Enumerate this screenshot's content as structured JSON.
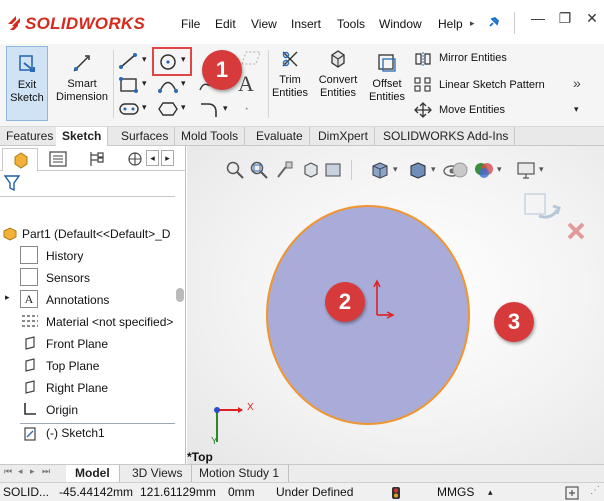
{
  "app": {
    "logo_text": "SOLIDWORKS"
  },
  "menu": {
    "items": [
      "File",
      "Edit",
      "View",
      "Insert",
      "Tools",
      "Window",
      "Help"
    ]
  },
  "ribbon": {
    "exit_sketch": "Exit\nSketch",
    "smart_dimension": "Smart\nDimension",
    "trim_entities": "Trim\nEntities",
    "convert_entities": "Convert\nEntities",
    "offset_entities": "Offset\nEntities",
    "mirror_entities": "Mirror Entities",
    "linear_sketch_pattern": "Linear Sketch Pattern",
    "move_entities": "Move Entities"
  },
  "tabs": [
    "Features",
    "Sketch",
    "Surfaces",
    "Mold Tools",
    "Evaluate",
    "DimXpert",
    "SOLIDWORKS Add-Ins"
  ],
  "active_tab": "Sketch",
  "tree": {
    "root": "Part1  (Default<<Default>_D",
    "items": [
      "History",
      "Sensors",
      "Annotations",
      "Material <not specified>",
      "Front Plane",
      "Top Plane",
      "Right Plane",
      "Origin",
      "(-) Sketch1"
    ]
  },
  "viewport": {
    "triad_x": "X",
    "triad_y": "Y",
    "view_label": "*Top",
    "circle_fill": "#a9acd9",
    "circle_stroke": "#f0952f"
  },
  "callouts": [
    "1",
    "2",
    "3"
  ],
  "bottom_tabs": [
    "Model",
    "3D Views",
    "Motion Study 1"
  ],
  "status": {
    "app": "SOLID...",
    "x": "-45.44142mm",
    "y": "121.61129mm",
    "z": "0mm",
    "state": "Under Defined",
    "units": "MMGS"
  },
  "colors": {
    "accent": "#d63a3a",
    "brand": "#d52b1e"
  }
}
